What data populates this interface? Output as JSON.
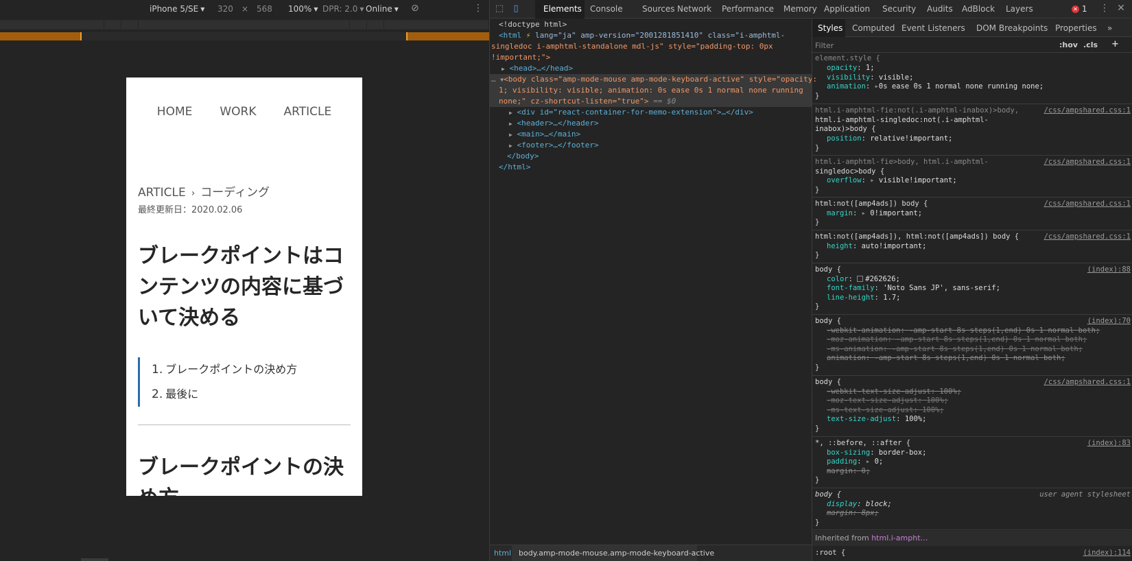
{
  "device_toolbar": {
    "device": "iPhone 5/SE",
    "width": "320",
    "times": "×",
    "height": "568",
    "zoom": "100%",
    "dpr": "DPR: 2.0",
    "network": "Online"
  },
  "page": {
    "nav": [
      "HOME",
      "WORK",
      "ARTICLE"
    ],
    "breadcrumb_root": "ARTICLE",
    "breadcrumb_sep": "›",
    "breadcrumb_current": "コーディング",
    "updated": "最終更新日：2020.02.06",
    "title": "ブレークポイントはコンテンツの内容に基づいて決める",
    "toc": [
      {
        "num": "1.",
        "label": "ブレークポイントの決め方"
      },
      {
        "num": "2.",
        "label": "最後に"
      }
    ],
    "section_title": "ブレークポイントの決め方"
  },
  "devtools_tabs": [
    "Elements",
    "Console",
    "Sources",
    "Network",
    "Performance",
    "Memory",
    "Application",
    "Security",
    "Audits",
    "AdBlock",
    "Layers"
  ],
  "active_tab": "Elements",
  "error_count": "1",
  "dom": {
    "doctype": "<!doctype html>",
    "html_open_tag": "<html",
    "html_attrs": " lang=\"ja\" amp-version=\"2001281851410\" class=\"i-amphtml-",
    "html_line2": "singledoc i-amphtml-standalone mdl-js\" style=\"padding-top: 0px",
    "html_line3": "!important;\">",
    "head": "<head>…</head>",
    "body_line1": "<body class=\"amp-mode-mouse amp-mode-keyboard-active\" style=\"opacity:",
    "body_line2": "1; visibility: visible; animation: 0s ease 0s 1 normal none running",
    "body_line3": "none;\" cz-shortcut-listen=\"true\">",
    "body_eq": " == $0",
    "div_line": "<div id=\"react-container-for-memo-extension\">…</div>",
    "header": "<header>…</header>",
    "main": "<main>…</main>",
    "footer": "<footer>…</footer>",
    "body_close": "</body>",
    "html_close": "</html>"
  },
  "dom_crumbs": [
    "html",
    "body.amp-mode-mouse.amp-mode-keyboard-active"
  ],
  "styles_tabs": [
    "Styles",
    "Computed",
    "Event Listeners",
    "DOM Breakpoints",
    "Properties"
  ],
  "filter_placeholder": "Filter",
  "filter_buttons": [
    ":hov",
    ".cls",
    "+"
  ],
  "rules": {
    "r1_sel": "element.style {",
    "r1_p1": "opacity",
    "r1_v1": "1;",
    "r1_p2": "visibility",
    "r1_v2": "visible;",
    "r1_p3": "animation",
    "r1_v3": "0s ease 0s 1 normal none running none;",
    "r2_sel1": "html.i-amphtml-fie:not(.i-amphtml-inabox)>body,",
    "r2_sel2": "html.i-amphtml-singledoc:not(.i-amphtml-",
    "r2_sel3": "inabox)>body {",
    "r2_p1": "position",
    "r2_v1": "relative!important;",
    "src_ampshared": "/css/ampshared.css:1",
    "r3_sel1": "html.i-amphtml-fie>body, html.i-amphtml-",
    "r3_sel2": "singledoc>body {",
    "r3_p1": "overflow",
    "r3_v1": "visible!important;",
    "r4_sel": "html:not([amp4ads]) body {",
    "r4_p1": "margin",
    "r4_v1": "0!important;",
    "r5_sel": "html:not([amp4ads]), html:not([amp4ads]) body {",
    "r5_p1": "height",
    "r5_v1": "auto!important;",
    "r6_sel": "body {",
    "r6_src": "(index):88",
    "r6_p1": "color",
    "r6_v1": "#262626;",
    "r6_p2": "font-family",
    "r6_v2": "'Noto Sans JP', sans-serif;",
    "r6_p3": "line-height",
    "r6_v3": "1.7;",
    "r7_sel": "body {",
    "r7_src": "(index):70",
    "r7_l1": "-webkit-animation: -amp-start 8s steps(1,end) 0s 1 normal both;",
    "r7_l2": "-moz-animation: -amp-start 8s steps(1,end) 0s 1 normal both;",
    "r7_l3": "-ms-animation: -amp-start 8s steps(1,end) 0s 1 normal both;",
    "r7_l4": "animation: -amp-start 8s steps(1,end) 0s 1 normal both;",
    "r8_sel": "body {",
    "r8_l1": "-webkit-text-size-adjust: 100%;",
    "r8_l2": "-moz-text-size-adjust: 100%;",
    "r8_l3": "-ms-text-size-adjust: 100%;",
    "r8_p4": "text-size-adjust",
    "r8_v4": "100%;",
    "r9_sel": "*, ::before, ::after {",
    "r9_src": "(index):83",
    "r9_p1": "box-sizing",
    "r9_v1": "border-box;",
    "r9_p2": "padding",
    "r9_v2": "0;",
    "r9_l3": "margin: 0;",
    "r10_sel": "body {",
    "r10_src": "user agent stylesheet",
    "r10_p1": "display",
    "r10_v1": "block;",
    "r10_l2": "margin: 8px;",
    "inherited_label": "Inherited from ",
    "inherited_tag": "html.i-ampht…",
    "root_sel": ":root {",
    "root_src": "(index):114",
    "close": "}"
  }
}
